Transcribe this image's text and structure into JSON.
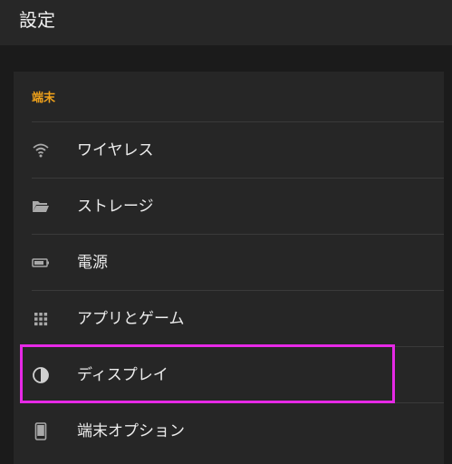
{
  "header": {
    "title": "設定"
  },
  "section": {
    "title": "端末"
  },
  "items": [
    {
      "label": "ワイヤレス",
      "icon": "wifi-icon"
    },
    {
      "label": "ストレージ",
      "icon": "folder-icon"
    },
    {
      "label": "電源",
      "icon": "battery-icon"
    },
    {
      "label": "アプリとゲーム",
      "icon": "grid-icon"
    },
    {
      "label": "ディスプレイ",
      "icon": "half-circle-icon",
      "highlighted": true
    },
    {
      "label": "端末オプション",
      "icon": "phone-icon"
    }
  ],
  "colors": {
    "accent": "#f0a21b",
    "highlight": "#e629e6"
  }
}
